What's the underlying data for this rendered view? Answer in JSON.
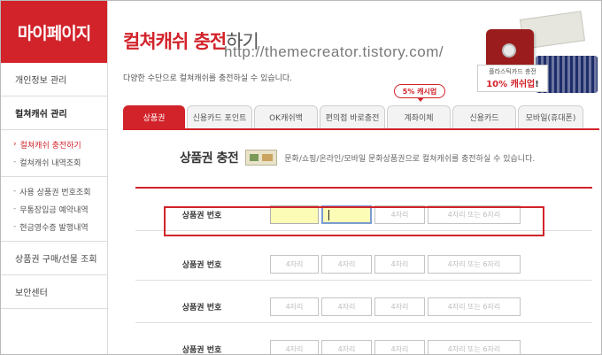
{
  "sidebar": {
    "title": "마이페이지",
    "sections": [
      {
        "label": "개인정보 관리"
      },
      {
        "label": "컬쳐캐쉬 관리"
      }
    ],
    "sub_items_1": [
      {
        "label": "컬쳐캐쉬 충전하기"
      },
      {
        "label": "컬쳐캐쉬 내역조회"
      }
    ],
    "sub_items_2": [
      {
        "label": "사용 상품권 번호조회"
      },
      {
        "label": "무통장입금 예약내역"
      },
      {
        "label": "현금영수증 발행내역"
      }
    ],
    "bottom_sections": [
      {
        "label": "상품권 구매/선물 조회"
      },
      {
        "label": "보안센터"
      }
    ]
  },
  "header": {
    "title_red": "컬쳐캐쉬 충전",
    "title_gray": "하기",
    "description": "다양한 수단으로 컬쳐캐쉬를 충전하실 수 있습니다.",
    "watermark": "http://themecreator.tistory.com/"
  },
  "promo": {
    "line1": "플라스틱카드 충전",
    "line2_red": "10% 캐쉬업",
    "line2_tail": "!"
  },
  "tabs": [
    {
      "label": "상품권"
    },
    {
      "label": "신용카드 포인트"
    },
    {
      "label": "OK캐쉬백"
    },
    {
      "label": "편의점 바로충전"
    },
    {
      "label": "계좌이체"
    },
    {
      "label": "신용카드"
    },
    {
      "label": "모바일(휴대폰)"
    }
  ],
  "badge": "5% 캐시업",
  "section": {
    "heading": "상품권 충전",
    "description": "문화/쇼핑/온라인/모바일 문화상품권으로 컬쳐캐쉬를 충전하실 수 있습니다."
  },
  "form": {
    "row_label": "상품권 번호",
    "placeholder_4": "4자리",
    "placeholder_4_6": "4자리 또는 6자리"
  },
  "colors": {
    "brand_red": "#d2232a",
    "input_highlight": "#fdfcb7"
  }
}
